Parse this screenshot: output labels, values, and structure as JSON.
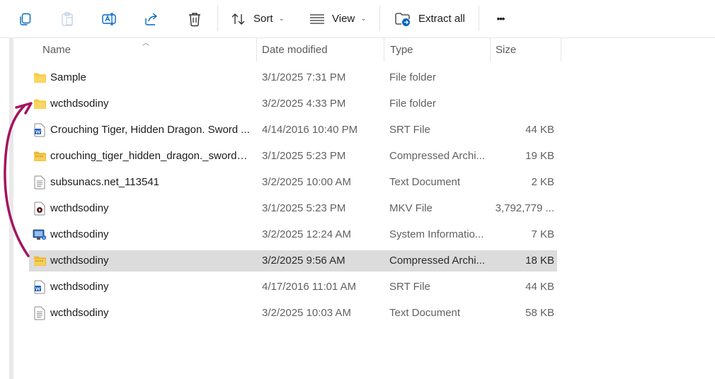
{
  "toolbar": {
    "sort_label": "Sort",
    "view_label": "View",
    "extract_label": "Extract all",
    "more_label": "•••"
  },
  "columns": {
    "name": "Name",
    "date": "Date modified",
    "type": "Type",
    "size": "Size"
  },
  "files": [
    {
      "icon": "folder-icon",
      "name": "Sample",
      "date": "3/1/2025 7:31 PM",
      "type": "File folder",
      "size": ""
    },
    {
      "icon": "folder-icon",
      "name": "wcthdsodiny",
      "date": "3/2/2025 4:33 PM",
      "type": "File folder",
      "size": ""
    },
    {
      "icon": "word-document-icon",
      "name": "Crouching Tiger, Hidden Dragon. Sword ...",
      "date": "4/14/2016 10:40 PM",
      "type": "SRT File",
      "size": "44 KB"
    },
    {
      "icon": "zip-folder-icon",
      "name": "crouching_tiger_hidden_dragon._sword_o...",
      "date": "3/1/2025 5:23 PM",
      "type": "Compressed Archi...",
      "size": "19 KB"
    },
    {
      "icon": "text-document-icon",
      "name": "subsunacs.net_113541",
      "date": "3/2/2025 10:00 AM",
      "type": "Text Document",
      "size": "2 KB"
    },
    {
      "icon": "video-file-icon",
      "name": "wcthdsodiny",
      "date": "3/1/2025 5:23 PM",
      "type": "MKV File",
      "size": "3,792,779 ..."
    },
    {
      "icon": "system-info-icon",
      "name": "wcthdsodiny",
      "date": "3/2/2025 12:24 AM",
      "type": "System Informatio...",
      "size": "7 KB"
    },
    {
      "icon": "zip-folder-icon",
      "name": "wcthdsodiny",
      "date": "3/2/2025 9:56 AM",
      "type": "Compressed Archi...",
      "size": "18 KB",
      "selected": true
    },
    {
      "icon": "word-document-icon",
      "name": "wcthdsodiny",
      "date": "4/17/2016 11:01 AM",
      "type": "SRT File",
      "size": "44 KB"
    },
    {
      "icon": "text-document-icon",
      "name": "wcthdsodiny",
      "date": "3/2/2025 10:03 AM",
      "type": "Text Document",
      "size": "58 KB"
    }
  ],
  "colors": {
    "accent": "#0067c0",
    "folder": "#f8c942",
    "selected_row": "#dcdcdc",
    "annotation_arrow": "#a3135f"
  }
}
